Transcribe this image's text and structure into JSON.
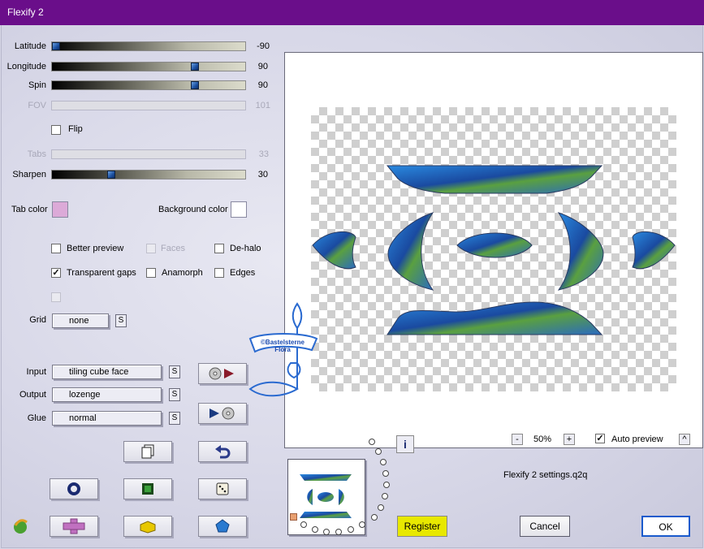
{
  "window": {
    "title": "Flexify 2"
  },
  "sliders": {
    "latitude": {
      "label": "Latitude",
      "value": "-90",
      "fraction": 0.0
    },
    "longitude": {
      "label": "Longitude",
      "value": "90",
      "fraction": 0.75
    },
    "spin": {
      "label": "Spin",
      "value": "90",
      "fraction": 0.75
    },
    "fov": {
      "label": "FOV",
      "value": "101",
      "disabled": true
    },
    "tabs": {
      "label": "Tabs",
      "value": "33",
      "disabled": true
    },
    "sharpen": {
      "label": "Sharpen",
      "value": "30",
      "fraction": 0.3
    }
  },
  "flip": {
    "label": "Flip",
    "checked": false
  },
  "colors": {
    "tab_color_label": "Tab color",
    "tab_color": "#dcaad8",
    "background_color_label": "Background color",
    "background_color": "#ffffff"
  },
  "options": {
    "better_preview": {
      "label": "Better preview",
      "checked": false
    },
    "faces": {
      "label": "Faces",
      "checked": false,
      "disabled": true
    },
    "de_halo": {
      "label": "De-halo",
      "checked": false
    },
    "transparent_gaps": {
      "label": "Transparent gaps",
      "checked": true
    },
    "anamorph": {
      "label": "Anamorph",
      "checked": false
    },
    "edges": {
      "label": "Edges",
      "checked": false
    }
  },
  "grid": {
    "label": "Grid",
    "value": "none",
    "s": "S"
  },
  "projection": {
    "input": {
      "label": "Input",
      "value": "tiling cube face",
      "s": "S"
    },
    "output": {
      "label": "Output",
      "value": "lozenge",
      "s": "S"
    },
    "glue": {
      "label": "Glue",
      "value": "normal",
      "s": "S"
    }
  },
  "zoom": {
    "minus": "-",
    "value": "50%",
    "plus": "+"
  },
  "auto_preview": {
    "label": "Auto preview",
    "checked": true,
    "arrow": "^"
  },
  "info_icon": "i",
  "settings_file": "Flexify 2 settings.q2q",
  "buttons": {
    "register": "Register",
    "cancel": "Cancel",
    "ok": "OK"
  },
  "watermark_text": "©Bastelsterne Flora",
  "icons": {
    "input_apply": "disc-arrow-icon",
    "output_apply": "arrow-disc-icon",
    "copy": "copy-icon",
    "undo": "undo-icon",
    "ring": "ring-icon",
    "square": "square-icon",
    "dice": "dice-icon",
    "cross": "cross-icon",
    "brick": "brick-icon",
    "pentagon": "pentagon-icon",
    "logo": "flexify-logo-icon"
  }
}
